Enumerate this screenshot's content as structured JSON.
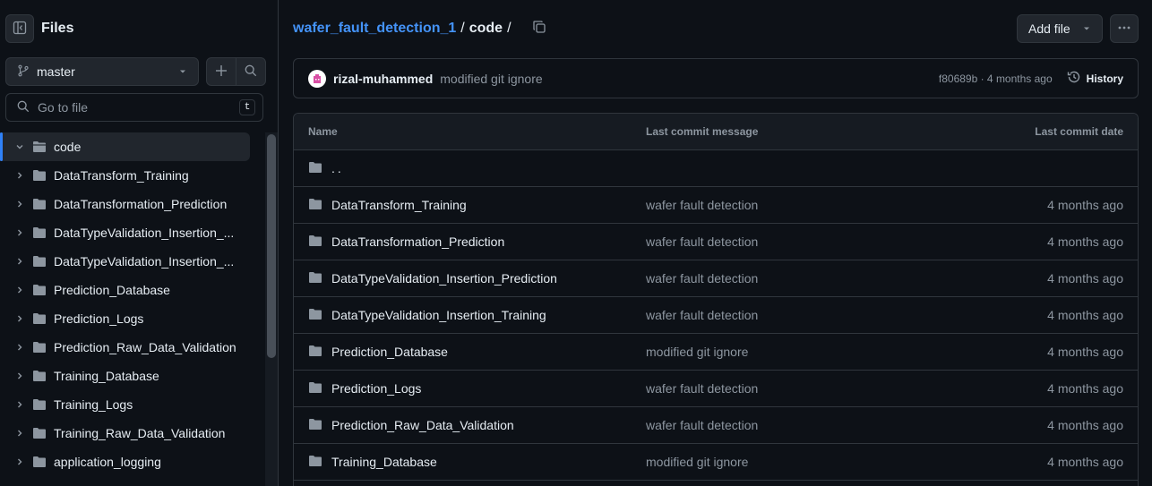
{
  "sidebar": {
    "title": "Files",
    "branch": "master",
    "goto_placeholder": "Go to file",
    "goto_shortcut": "t",
    "tree": [
      {
        "label": "code",
        "expanded": true,
        "active": true,
        "depth": 0
      },
      {
        "label": "DataTransform_Training",
        "depth": 1
      },
      {
        "label": "DataTransformation_Prediction",
        "depth": 1
      },
      {
        "label": "DataTypeValidation_Insertion_...",
        "depth": 1
      },
      {
        "label": "DataTypeValidation_Insertion_...",
        "depth": 1
      },
      {
        "label": "Prediction_Database",
        "depth": 1
      },
      {
        "label": "Prediction_Logs",
        "depth": 1
      },
      {
        "label": "Prediction_Raw_Data_Validation",
        "depth": 1
      },
      {
        "label": "Training_Database",
        "depth": 1
      },
      {
        "label": "Training_Logs",
        "depth": 1
      },
      {
        "label": "Training_Raw_Data_Validation",
        "depth": 1
      },
      {
        "label": "application_logging",
        "depth": 1
      }
    ]
  },
  "breadcrumb": {
    "repo": "wafer_fault_detection_1",
    "sep1": "/",
    "current": "code",
    "sep2": "/"
  },
  "toolbar": {
    "add_file": "Add file"
  },
  "commit": {
    "author": "rizal-muhammed",
    "message": "modified git ignore",
    "meta": "f80689b · 4 months ago",
    "history": "History"
  },
  "table": {
    "headers": {
      "name": "Name",
      "message": "Last commit message",
      "date": "Last commit date"
    },
    "parent": "..",
    "rows": [
      {
        "name": "DataTransform_Training",
        "message": "wafer fault detection",
        "date": "4 months ago"
      },
      {
        "name": "DataTransformation_Prediction",
        "message": "wafer fault detection",
        "date": "4 months ago"
      },
      {
        "name": "DataTypeValidation_Insertion_Prediction",
        "message": "wafer fault detection",
        "date": "4 months ago"
      },
      {
        "name": "DataTypeValidation_Insertion_Training",
        "message": "wafer fault detection",
        "date": "4 months ago"
      },
      {
        "name": "Prediction_Database",
        "message": "modified git ignore",
        "date": "4 months ago"
      },
      {
        "name": "Prediction_Logs",
        "message": "wafer fault detection",
        "date": "4 months ago"
      },
      {
        "name": "Prediction_Raw_Data_Validation",
        "message": "wafer fault detection",
        "date": "4 months ago"
      },
      {
        "name": "Training_Database",
        "message": "modified git ignore",
        "date": "4 months ago"
      }
    ]
  },
  "colors": {
    "link": "#4493f8",
    "muted": "#8d96a0",
    "border": "#30363d",
    "bg": "#0d1117"
  }
}
